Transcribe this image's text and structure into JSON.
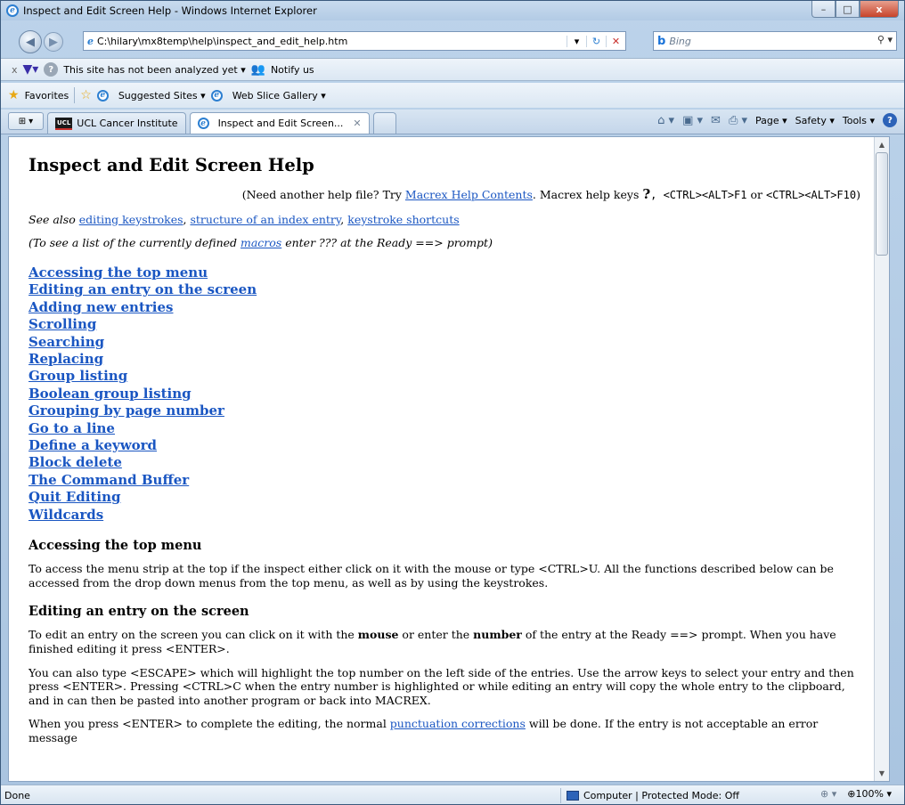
{
  "window": {
    "title": "Inspect and Edit Screen Help - Windows Internet Explorer",
    "minimize": "–",
    "maximize": "□",
    "close": "x"
  },
  "address": {
    "url": "C:\\hilary\\mx8temp\\help\\inspect_and_edit_help.htm",
    "search_placeholder": "Bing",
    "search_engine": "b"
  },
  "command_bar": {
    "close": "x",
    "site_status": "This site has not been analyzed yet ▾",
    "notify": "Notify us"
  },
  "favorites_bar": {
    "favorites": "Favorites",
    "suggested_sites": "Suggested Sites ▾",
    "web_slice_gallery": "Web Slice Gallery ▾"
  },
  "tabs": [
    {
      "label": "UCL Cancer Institute",
      "logo": "UCL"
    },
    {
      "label": "Inspect and Edit Screen...",
      "close": "✕"
    }
  ],
  "toolbar_right": {
    "page": "Page ▾",
    "safety": "Safety ▾",
    "tools": "Tools ▾"
  },
  "content": {
    "title": "Inspect and Edit Screen Help",
    "help_pre": "(Need another help file? Try ",
    "help_link": "Macrex Help Contents",
    "help_mid": ". Macrex help keys ",
    "help_q": "?",
    "help_keys1": ",  <CTRL><ALT>F1",
    "help_or": " or ",
    "help_keys2": "<CTRL><ALT>F10",
    "help_end": ")",
    "see_also_label": "See also",
    "see_also_links": [
      "editing keystrokes",
      "structure of an index entry",
      "keystroke shortcuts"
    ],
    "macros_pre": "(To see a list of the currently defined ",
    "macros_link": "macros",
    "macros_post": " enter ??? at the Ready ==> prompt)",
    "toc": [
      "Accessing the top menu",
      "Editing an entry on the screen",
      "Adding new entries",
      "Scrolling",
      "Searching",
      "Replacing",
      "Group listing",
      "Boolean group listing",
      "Grouping by page number",
      "Go to a line",
      "Define a keyword",
      "Block delete",
      "The Command Buffer",
      "Quit Editing",
      "Wildcards"
    ],
    "section1_title": "Accessing the top menu",
    "section1_text": "To access the menu strip at the top if the inspect either click on it with the mouse or type <CTRL>U.  All the functions described below can be accessed from the drop down menus from the top menu, as well as by using the keystrokes.",
    "section2_title": "Editing an entry on the screen",
    "section2_p1_a": "To edit an entry on the screen you can click on it with the ",
    "section2_p1_mouse": "mouse",
    "section2_p1_b": " or enter the ",
    "section2_p1_number": "number",
    "section2_p1_c": " of the entry at the Ready ==> prompt. When you have finished editing it press <ENTER>.",
    "section2_p2": "You can also type <ESCAPE> which will highlight the top number on the left side of the entries.  Use the arrow keys to select your entry and then press <ENTER>.  Pressing <CTRL>C when the entry number is highlighted or while editing an entry will copy the whole entry to the clipboard, and in can then be pasted into another program or back into MACREX.",
    "section2_p3_a": "When you press <ENTER> to complete the editing, the normal ",
    "section2_p3_link": "punctuation corrections",
    "section2_p3_b": " will be done. If the entry is not acceptable an error message"
  },
  "status": {
    "left": "Done",
    "zone": "Computer | Protected Mode: Off",
    "zoom": "100%"
  }
}
